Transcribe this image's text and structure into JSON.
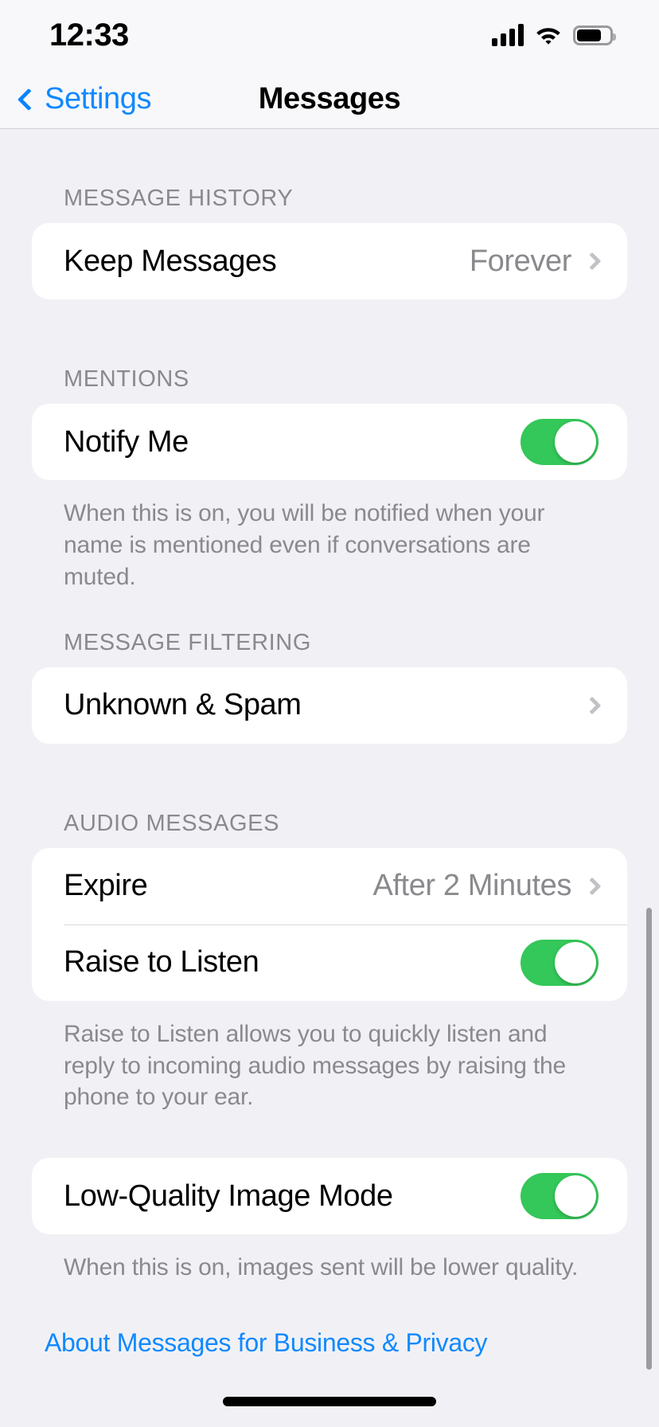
{
  "status_bar": {
    "time": "12:33",
    "signal_icon": "cellular-bars-icon",
    "wifi_icon": "wifi-icon",
    "battery_icon": "battery-icon",
    "battery_level_pct": 75
  },
  "nav_bar": {
    "back_label": "Settings",
    "back_icon": "chevron-left-icon",
    "title": "Messages"
  },
  "colors": {
    "accent_blue": "#1089FF",
    "toggle_on_green": "#34C759",
    "page_background": "#F1F1F5",
    "card_background": "#FFFFFF",
    "secondary_text": "#8A8A8E"
  },
  "sections": [
    {
      "header": "MESSAGE HISTORY",
      "rows": [
        {
          "label": "Keep Messages",
          "value": "Forever",
          "accessory": "chevron-right-icon"
        }
      ],
      "footer": ""
    },
    {
      "header": "MENTIONS",
      "rows": [
        {
          "label": "Notify Me",
          "accessory": "toggle",
          "toggle_on": true
        }
      ],
      "footer": "When this is on, you will be notified when your name is mentioned even if conversations are muted."
    },
    {
      "header": "MESSAGE FILTERING",
      "rows": [
        {
          "label": "Unknown & Spam",
          "value": "",
          "accessory": "chevron-right-icon"
        }
      ],
      "footer": ""
    },
    {
      "header": "AUDIO MESSAGES",
      "rows": [
        {
          "label": "Expire",
          "value": "After 2 Minutes",
          "accessory": "chevron-right-icon"
        },
        {
          "label": "Raise to Listen",
          "accessory": "toggle",
          "toggle_on": true
        }
      ],
      "footer": "Raise to Listen allows you to quickly listen and reply to incoming audio messages by raising the phone to your ear."
    },
    {
      "header": "",
      "rows": [
        {
          "label": "Low-Quality Image Mode",
          "accessory": "toggle",
          "toggle_on": true
        }
      ],
      "footer": "When this is on, images sent will be lower quality."
    }
  ],
  "link": {
    "label": "About Messages for Business & Privacy"
  },
  "scrollbar": {
    "visible": true
  },
  "home_indicator": {
    "visible": true
  }
}
